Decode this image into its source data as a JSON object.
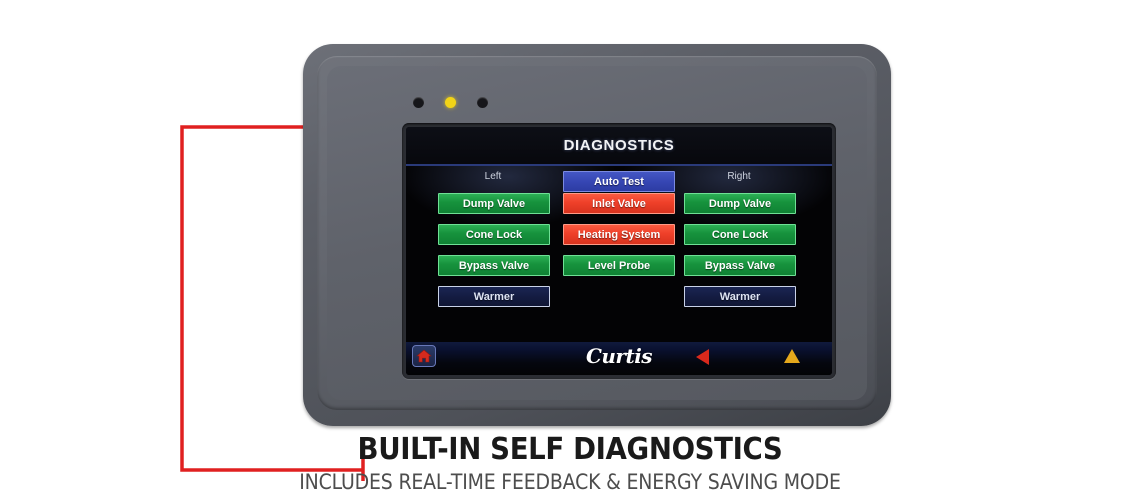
{
  "device": {
    "leds": [
      {
        "name": "led-1",
        "color": "#16161a"
      },
      {
        "name": "led-2",
        "color": "#f2d417"
      },
      {
        "name": "led-3",
        "color": "#16161a"
      }
    ]
  },
  "screen": {
    "header": {
      "title": "DIAGNOSTICS"
    },
    "columns": {
      "left_label": "Left",
      "right_label": "Right"
    },
    "auto_test_label": "Auto Test",
    "buttons": {
      "left": [
        {
          "label": "Dump Valve",
          "state": "green"
        },
        {
          "label": "Cone Lock",
          "state": "green"
        },
        {
          "label": "Bypass Valve",
          "state": "green"
        },
        {
          "label": "Warmer",
          "state": "navy"
        }
      ],
      "center": [
        {
          "label": "Inlet Valve",
          "state": "red"
        },
        {
          "label": "Heating System",
          "state": "red"
        },
        {
          "label": "Level Probe",
          "state": "green"
        }
      ],
      "right": [
        {
          "label": "Dump Valve",
          "state": "green"
        },
        {
          "label": "Cone Lock",
          "state": "green"
        },
        {
          "label": "Bypass Valve",
          "state": "green"
        },
        {
          "label": "Warmer",
          "state": "navy"
        }
      ]
    },
    "footer": {
      "home_icon": "home-icon",
      "brand": "Curtis",
      "back_icon": "triangle-left-icon",
      "up_icon": "triangle-up-icon"
    }
  },
  "callout": {
    "marker": "callout-dot",
    "color": "#e02020"
  },
  "caption": {
    "headline": "BUILT-IN SELF DIAGNOSTICS",
    "subhead": "INCLUDES REAL-TIME FEEDBACK & ENERGY SAVING MODE"
  },
  "colors": {
    "ok": "#17933d",
    "fault": "#ef4029",
    "info": "#3545b2",
    "standby": "#141c42",
    "accent_red": "#e02020",
    "body_gray": "#5f626a"
  }
}
